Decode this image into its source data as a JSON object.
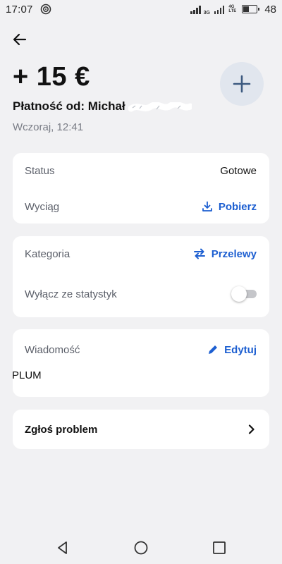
{
  "status_bar": {
    "time": "17:07",
    "net_3g": "3G",
    "net_4g_top": "4G",
    "net_4g_bottom": "LTE",
    "battery_level": 0.48,
    "battery_pct": "48"
  },
  "header": {
    "amount": "+ 15 €",
    "payer_prefix": "Płatność od: Michał",
    "date": "Wczoraj, 12:41"
  },
  "card_details": {
    "status_label": "Status",
    "status_value": "Gotowe",
    "statement_label": "Wyciąg",
    "download_label": "Pobierz"
  },
  "card_category": {
    "category_label": "Kategoria",
    "category_value": "Przelewy",
    "exclude_label": "Wyłącz ze statystyk",
    "exclude_enabled": false
  },
  "card_message": {
    "message_label": "Wiadomość",
    "edit_label": "Edytuj",
    "message_text": "PLUM"
  },
  "card_report": {
    "report_label": "Zgłoś problem"
  },
  "colors": {
    "background": "#f1f1f3",
    "accent_blue": "#1d5fd1",
    "label_gray": "#5c606a"
  }
}
